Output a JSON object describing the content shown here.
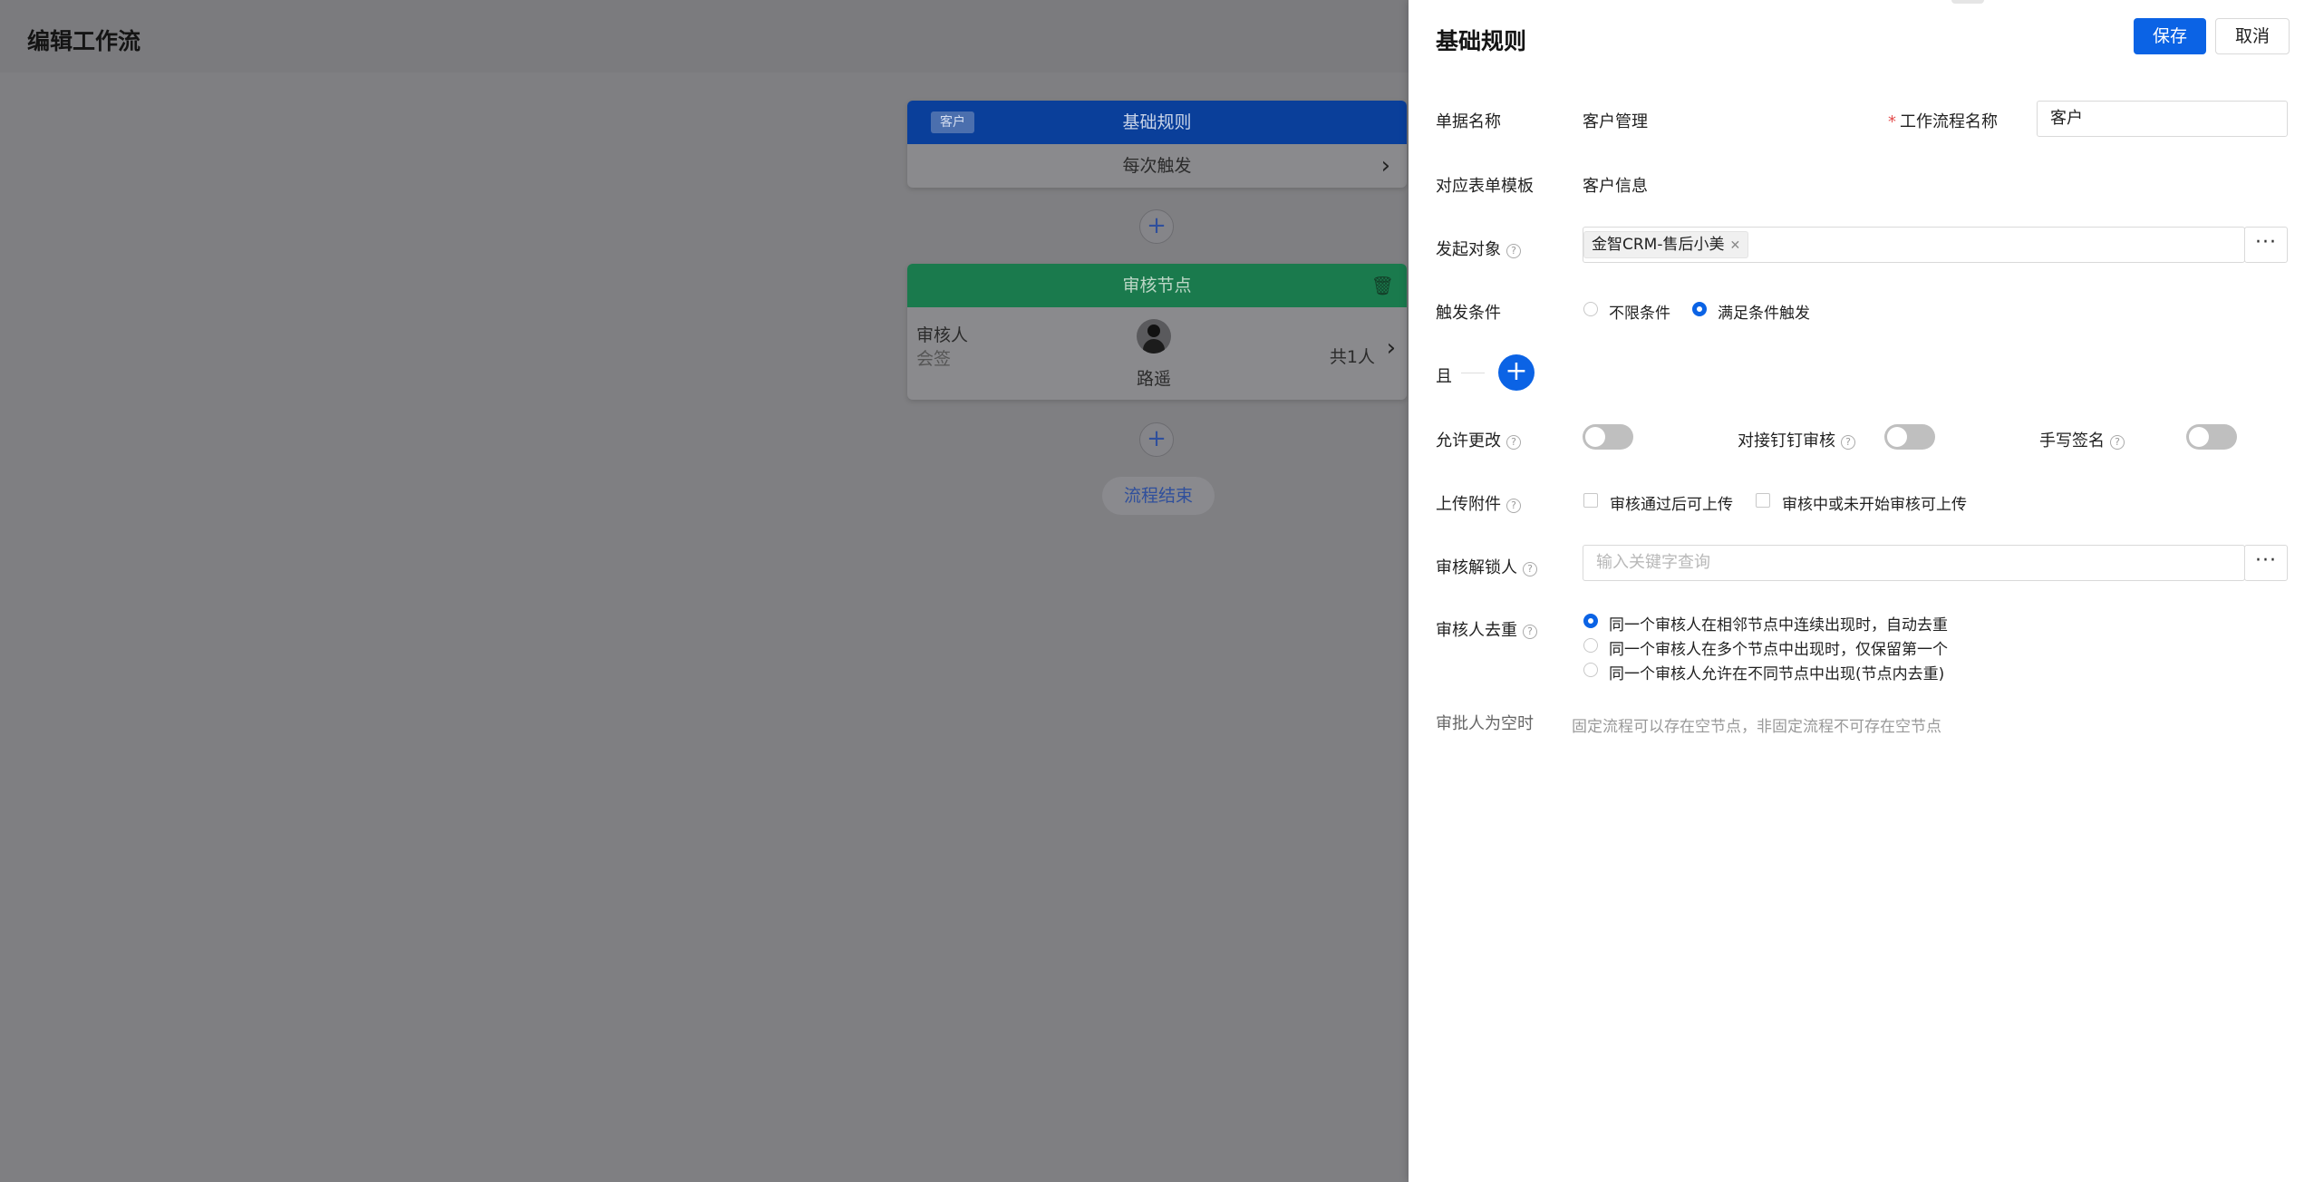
{
  "page": {
    "title": "编辑工作流"
  },
  "canvas": {
    "start_node": {
      "tag": "客户",
      "title": "基础规则",
      "trigger": "每次触发"
    },
    "review_node": {
      "title": "审核节点",
      "role_label": "审核人",
      "mode_label": "会签",
      "reviewer_name": "路遥",
      "count_label": "共1人"
    },
    "end_label": "流程结束"
  },
  "drawer": {
    "title": "基础规则",
    "save_label": "保存",
    "cancel_label": "取消",
    "form_name": {
      "label": "单据名称",
      "value": "客户管理"
    },
    "workflow_name": {
      "label": "工作流程名称",
      "value": "客户"
    },
    "template": {
      "label": "对应表单模板",
      "value": "客户信息"
    },
    "initiator": {
      "label": "发起对象",
      "chip": "金智CRM-售后小美"
    },
    "trigger": {
      "label": "触发条件",
      "options": [
        "不限条件",
        "满足条件触发"
      ],
      "selected": 1
    },
    "and_label": "且",
    "allow_change": {
      "label": "允许更改",
      "on": false
    },
    "dingtalk": {
      "label": "对接钉钉审核",
      "on": false
    },
    "signature": {
      "label": "手写签名",
      "on": false
    },
    "attachment": {
      "label": "上传附件",
      "options": [
        "审核通过后可上传",
        "审核中或未开始审核可上传"
      ]
    },
    "unlocker": {
      "label": "审核解锁人",
      "placeholder": "输入关键字查询"
    },
    "dedup": {
      "label": "审核人去重",
      "options": [
        "同一个审核人在相邻节点中连续出现时，自动去重",
        "同一个审核人在多个节点中出现时，仅保留第一个",
        "同一个审核人允许在不同节点中出现(节点内去重)"
      ],
      "selected": 0
    },
    "empty_approver": {
      "label": "审批人为空时",
      "note": "固定流程可以存在空节点，非固定流程不可存在空节点"
    }
  },
  "colors": {
    "primary": "#0b63e5",
    "start_head": "#0a3f9a",
    "review_head": "#1a7a4d"
  },
  "icons": {
    "delete": "trash-icon",
    "more": "ellipsis-icon",
    "help": "question-circle-icon",
    "next": "chevron-right-icon"
  }
}
